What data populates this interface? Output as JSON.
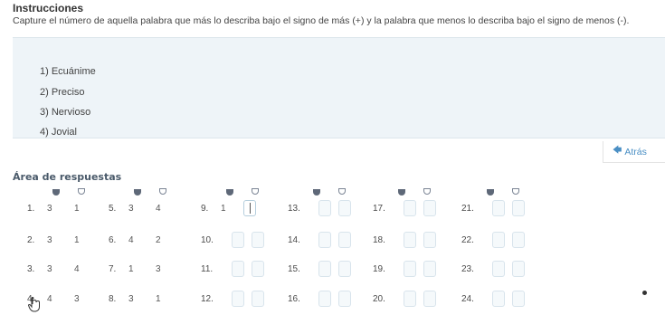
{
  "instructions": {
    "title": "Instrucciones",
    "description": "Capture el número de aquella palabra que más lo describa bajo el signo de más (+) y la palabra que menos lo describa bajo el signo de menos (-)."
  },
  "words": [
    "1) Ecuánime",
    "2) Preciso",
    "3) Nervioso",
    "4) Jovial"
  ],
  "back_button": {
    "arrow": "🡄",
    "label": "Atrás"
  },
  "answers": {
    "title": "Área de respuestas",
    "items": [
      {
        "n": "1.",
        "plus": "3",
        "minus": "1"
      },
      {
        "n": "2.",
        "plus": "3",
        "minus": "1"
      },
      {
        "n": "3.",
        "plus": "3",
        "minus": "4"
      },
      {
        "n": "4.",
        "plus": "4",
        "minus": "3"
      },
      {
        "n": "5.",
        "plus": "3",
        "minus": "4"
      },
      {
        "n": "6.",
        "plus": "4",
        "minus": "2"
      },
      {
        "n": "7.",
        "plus": "1",
        "minus": "3"
      },
      {
        "n": "8.",
        "plus": "3",
        "minus": "1"
      },
      {
        "n": "9.",
        "plus": "1",
        "minus": ""
      },
      {
        "n": "10.",
        "plus": "",
        "minus": ""
      },
      {
        "n": "11.",
        "plus": "",
        "minus": ""
      },
      {
        "n": "12.",
        "plus": "",
        "minus": ""
      },
      {
        "n": "13.",
        "plus": "",
        "minus": ""
      },
      {
        "n": "14.",
        "plus": "",
        "minus": ""
      },
      {
        "n": "15.",
        "plus": "",
        "minus": ""
      },
      {
        "n": "16.",
        "plus": "",
        "minus": ""
      },
      {
        "n": "17.",
        "plus": "",
        "minus": ""
      },
      {
        "n": "18.",
        "plus": "",
        "minus": ""
      },
      {
        "n": "19.",
        "plus": "",
        "minus": ""
      },
      {
        "n": "20.",
        "plus": "",
        "minus": ""
      },
      {
        "n": "21.",
        "plus": "",
        "minus": ""
      },
      {
        "n": "22.",
        "plus": "",
        "minus": ""
      },
      {
        "n": "23.",
        "plus": "",
        "minus": ""
      },
      {
        "n": "24.",
        "plus": "",
        "minus": ""
      }
    ]
  },
  "colors": {
    "accent": "#4a8fc4",
    "panel": "#eef4f8"
  }
}
